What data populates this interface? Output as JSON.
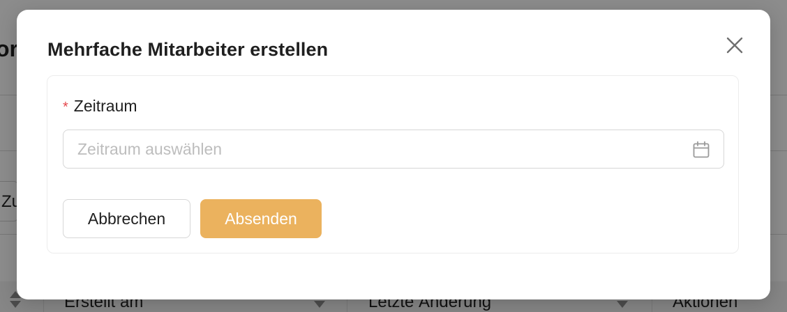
{
  "background": {
    "title_fragment": "or",
    "cell_fragment": "Zu",
    "columns": [
      "Erstellt am",
      "Letzte Änderung",
      "Aktionen"
    ]
  },
  "modal": {
    "title": "Mehrfache Mitarbeiter erstellen",
    "field": {
      "required_mark": "*",
      "label": "Zeitraum",
      "placeholder": "Zeitraum auswählen",
      "value": "",
      "icon": "calendar-icon"
    },
    "buttons": {
      "cancel": "Abbrechen",
      "submit": "Absenden"
    },
    "close_icon": "close-icon"
  },
  "colors": {
    "primary": "#ebb25e",
    "required": "#e5484d",
    "placeholder": "#bdbdbd",
    "text": "#1f1f1f"
  }
}
